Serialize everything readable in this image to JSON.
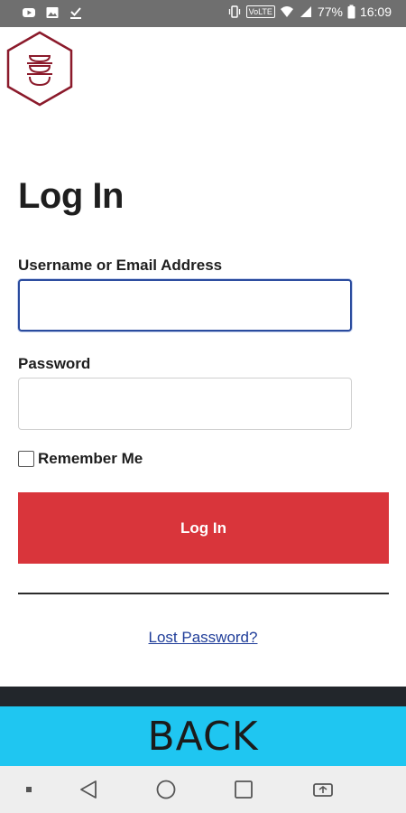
{
  "status_bar": {
    "left_icons": [
      "youtube-icon",
      "image-icon",
      "download-done-icon"
    ],
    "volte": "VoLTE",
    "battery": "77%",
    "time": "16:09"
  },
  "logo": {
    "icon": "stacked-bowls-logo-icon",
    "color": "#8b1a2b"
  },
  "form": {
    "title": "Log In",
    "username_label": "Username or Email Address",
    "username_value": "",
    "password_label": "Password",
    "password_value": "",
    "remember_label": "Remember Me",
    "remember_checked": false,
    "login_button": "Log In",
    "lost_password": "Lost Password?"
  },
  "back": {
    "label": "BACK"
  },
  "nav_bar": {
    "items": [
      "dot-icon",
      "back-triangle-icon",
      "home-circle-icon",
      "recents-square-icon",
      "screen-rotate-icon"
    ]
  },
  "colors": {
    "accent_red": "#d9353b",
    "back_bar": "#1fc6f1",
    "link_blue": "#1f3d99",
    "focus_border": "#2a4b9e"
  }
}
